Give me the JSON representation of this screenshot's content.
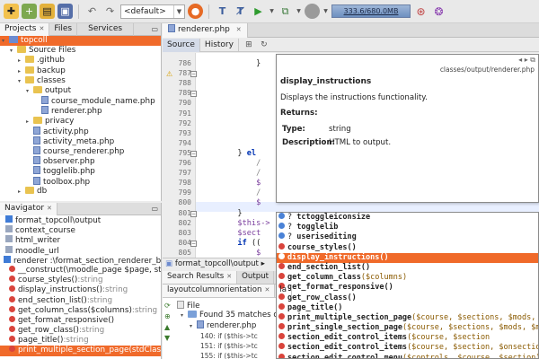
{
  "toolbar": {
    "config": "<default>",
    "memory": "333.6/680.0MB"
  },
  "projects": {
    "tabs": [
      {
        "label": "Projects"
      },
      {
        "label": "Files"
      },
      {
        "label": "Services"
      }
    ],
    "tree": [
      {
        "label": "topcoll",
        "depth": 0,
        "kind": "project",
        "selected": true
      },
      {
        "label": "Source Files",
        "depth": 1,
        "kind": "folder"
      },
      {
        "label": ".github",
        "depth": 2,
        "kind": "folder"
      },
      {
        "label": "backup",
        "depth": 2,
        "kind": "folder"
      },
      {
        "label": "classes",
        "depth": 2,
        "kind": "folder"
      },
      {
        "label": "output",
        "depth": 3,
        "kind": "folder"
      },
      {
        "label": "course_module_name.php",
        "depth": 4,
        "kind": "php"
      },
      {
        "label": "renderer.php",
        "depth": 4,
        "kind": "php"
      },
      {
        "label": "privacy",
        "depth": 3,
        "kind": "folder"
      },
      {
        "label": "activity.php",
        "depth": 3,
        "kind": "php"
      },
      {
        "label": "activity_meta.php",
        "depth": 3,
        "kind": "php"
      },
      {
        "label": "course_renderer.php",
        "depth": 3,
        "kind": "php"
      },
      {
        "label": "observer.php",
        "depth": 3,
        "kind": "php"
      },
      {
        "label": "togglelib.php",
        "depth": 3,
        "kind": "php"
      },
      {
        "label": "toolbox.php",
        "depth": 3,
        "kind": "php"
      },
      {
        "label": "db",
        "depth": 2,
        "kind": "folder"
      }
    ]
  },
  "navigator": {
    "title": "Navigator",
    "items": [
      {
        "label": "format_topcoll\\output",
        "kind": "ns"
      },
      {
        "label": "context_course",
        "kind": "ref"
      },
      {
        "label": "html_writer",
        "kind": "ref"
      },
      {
        "label": "moodle_url",
        "kind": "ref"
      },
      {
        "label": "renderer :\\format_section_renderer_bas",
        "kind": "class"
      },
      {
        "label": "__construct(\\moodle_page $page, strin",
        "kind": "method"
      },
      {
        "label": "course_styles()",
        "rtype": ":string",
        "kind": "method"
      },
      {
        "label": "display_instructions()",
        "rtype": ":string",
        "kind": "method"
      },
      {
        "label": "end_section_list()",
        "rtype": ":string",
        "kind": "method"
      },
      {
        "label": "get_column_class($columns)",
        "rtype": ":string",
        "kind": "method"
      },
      {
        "label": "get_format_responsive()",
        "kind": "method"
      },
      {
        "label": "get_row_class()",
        "rtype": ":string",
        "kind": "method"
      },
      {
        "label": "page_title()",
        "rtype": ":string",
        "kind": "method"
      },
      {
        "label": "print_multiple_section_page(stdClass $",
        "kind": "method",
        "selected": true
      }
    ]
  },
  "editor": {
    "tab_label": "renderer.php",
    "source_label": "Source",
    "history_label": "History",
    "lines": [
      {
        "num": "786",
        "code": "            }"
      },
      {
        "num": "787",
        "code": ""
      },
      {
        "num": "788",
        "code": ""
      },
      {
        "num": "789",
        "code": ""
      },
      {
        "num": "790",
        "code": ""
      },
      {
        "num": "791",
        "code": ""
      },
      {
        "num": "792",
        "code": ""
      },
      {
        "num": "793",
        "code": ""
      },
      {
        "num": "794",
        "code": ""
      },
      {
        "num": "795",
        "code": "        } el"
      },
      {
        "num": "796",
        "code": "            /"
      },
      {
        "num": "797",
        "code": "            /"
      },
      {
        "num": "798",
        "code": "            $"
      },
      {
        "num": "799",
        "code": "            /"
      },
      {
        "num": "800",
        "code": "            $"
      },
      {
        "num": "801",
        "code": "        }"
      },
      {
        "num": "802",
        "code": "        $this->"
      },
      {
        "num": "803",
        "code": "        $sect"
      },
      {
        "num": "804",
        "code": "        if (("
      },
      {
        "num": "805",
        "code": "            $"
      },
      {
        "num": "806",
        "code": "            $"
      },
      {
        "num": "807",
        "code": "        }"
      },
      {
        "num": "808",
        "code": "        $sect"
      }
    ]
  },
  "doc": {
    "path": "classes/output/renderer.php",
    "title": "display_instructions",
    "description": "Displays the instructions functionality.",
    "returns_label": "Returns:",
    "type_label": "Type:",
    "type_value": "string",
    "desc_label": "Description:",
    "desc_value": "HTML to output."
  },
  "completion": [
    {
      "name": "tctoggleiconsize",
      "prefix": "?"
    },
    {
      "name": "togglelib",
      "prefix": "?"
    },
    {
      "name": "userisediting",
      "prefix": "?"
    },
    {
      "name": "course_styles()"
    },
    {
      "name": "display_instructions()",
      "selected": true
    },
    {
      "name": "end_section_list()"
    },
    {
      "name": "get_column_class",
      "params": "($columns)"
    },
    {
      "name": "get_format_responsive()"
    },
    {
      "name": "get_row_class()"
    },
    {
      "name": "page_title()"
    },
    {
      "name": "print_multiple_section_page",
      "params": "($course, $sections, $mods, $"
    },
    {
      "name": "print_single_section_page",
      "params": "($course, $sections, $mods, $mo"
    },
    {
      "name": "section_edit_control_items",
      "params": "($course, $section"
    },
    {
      "name": "section_edit_control_items",
      "params": "($course, $section, $onsection"
    },
    {
      "name": "section_edit_control_menu",
      "params": "($controls, $course, $section)"
    },
    {
      "name": "section_hidden",
      "params": "($section)"
    }
  ],
  "bottom": {
    "breadcrumb": "format_topcoll\\output",
    "tabs": [
      {
        "label": "Search Results"
      },
      {
        "label": "Output"
      }
    ],
    "search_tabs": [
      {
        "label": "layoutcolumnorientation"
      },
      {
        "label": "la"
      }
    ],
    "results": [
      {
        "label": "File"
      },
      {
        "label": "Found 35 matches of"
      },
      {
        "label": "renderer.php"
      },
      {
        "label": "140: if ($this->tc"
      },
      {
        "label": "151: if ($this->tc"
      },
      {
        "label": "155: if ($this->tc"
      }
    ]
  }
}
